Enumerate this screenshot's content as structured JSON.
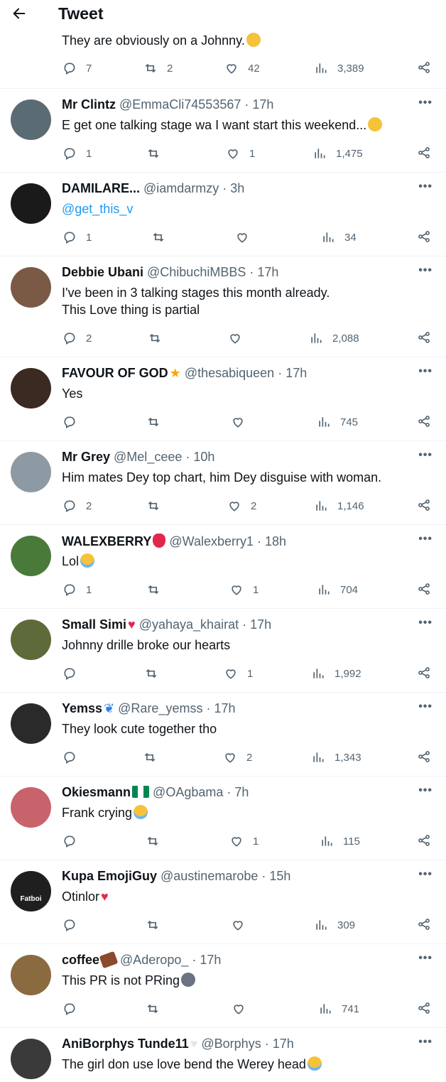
{
  "header": {
    "title": "Tweet"
  },
  "top": {
    "text": "They are obviously on a Johnny.",
    "emoji": "smiling-face-emoji",
    "replies": "7",
    "retweets": "2",
    "likes": "42",
    "views": "3,389"
  },
  "replies": [
    {
      "name": "Mr Clintz",
      "name_emoji": "",
      "handle": "@EmmaCli74553567",
      "time": "17h",
      "text": "E get one talking stage wa I want start this weekend...",
      "text_emoji": "sad-face-emoji",
      "is_link": false,
      "replies": "1",
      "retweets": "",
      "likes": "1",
      "views": "1,475",
      "avatar_color": "#5b6b74"
    },
    {
      "name": "DAMILARE...",
      "name_emoji": "",
      "handle": "@iamdarmzy",
      "time": "3h",
      "text": "@get_this_v",
      "text_emoji": "",
      "is_link": true,
      "replies": "1",
      "retweets": "",
      "likes": "",
      "views": "34",
      "avatar_color": "#1a1a1a"
    },
    {
      "name": "Debbie Ubani",
      "name_emoji": "",
      "handle": "@ChibuchiMBBS",
      "time": "17h",
      "text": "I've been in 3 talking stages this month already.\nThis Love thing is partial",
      "text_emoji": "",
      "is_link": false,
      "replies": "2",
      "retweets": "",
      "likes": "",
      "views": "2,088",
      "avatar_color": "#7a5a44"
    },
    {
      "name": "FAVOUR OF GOD",
      "name_emoji": "star-emoji",
      "handle": "@thesabiqueen",
      "time": "17h",
      "text": "Yes",
      "text_emoji": "",
      "is_link": false,
      "replies": "",
      "retweets": "",
      "likes": "",
      "views": "745",
      "avatar_color": "#3b2a22"
    },
    {
      "name": "Mr Grey",
      "name_emoji": "",
      "handle": "@Mel_ceee",
      "time": "10h",
      "text": "Him mates Dey  top chart, him Dey disguise with woman.",
      "text_emoji": "",
      "is_link": false,
      "replies": "2",
      "retweets": "",
      "likes": "2",
      "views": "1,146",
      "avatar_color": "#8e9aa3"
    },
    {
      "name": "WALEXBERRY",
      "name_emoji": "strawberry-emoji",
      "handle": "@Walexberry1",
      "time": "18h",
      "text": "Lol",
      "text_emoji": "crying-laughing-emoji",
      "is_link": false,
      "replies": "1",
      "retweets": "",
      "likes": "1",
      "views": "704",
      "avatar_color": "#4a7a3a"
    },
    {
      "name": "Small Simi",
      "name_emoji": "red-heart-emoji",
      "handle": "@yahaya_khairat",
      "time": "17h",
      "text": "Johnny drille broke our hearts",
      "text_emoji": "",
      "is_link": false,
      "replies": "",
      "retweets": "",
      "likes": "1",
      "views": "1,992",
      "avatar_color": "#5d6b3a"
    },
    {
      "name": "Yemss",
      "name_emoji": "butterfly-emoji",
      "handle": "@Rare_yemss",
      "time": "17h",
      "text": "They look cute together tho",
      "text_emoji": "",
      "is_link": false,
      "replies": "",
      "retweets": "",
      "likes": "2",
      "views": "1,343",
      "avatar_color": "#2a2a2a"
    },
    {
      "name": "Okiesmann",
      "name_emoji": "nigeria-flag-emoji",
      "handle": "@OAgbama",
      "time": "7h",
      "text": "Frank crying",
      "text_emoji": "loudly-crying-emoji",
      "is_link": false,
      "replies": "",
      "retweets": "",
      "likes": "1",
      "views": "115",
      "avatar_color": "#c9636b"
    },
    {
      "name": "Kupa EmojiGuy",
      "name_emoji": "",
      "handle": "@austinemarobe",
      "time": "15h",
      "text": "Otinlor",
      "text_emoji": "broken-heart-emoji",
      "is_link": false,
      "replies": "",
      "retweets": "",
      "likes": "",
      "views": "309",
      "avatar_color": "#1f1f1f",
      "avatar_text": "Fatboi"
    },
    {
      "name": "coffee",
      "name_emoji": "chocolate-emoji",
      "handle": "@Aderopo_",
      "time": "17h",
      "text": "This PR is not PRing",
      "text_emoji": "grimacing-emoji",
      "is_link": false,
      "replies": "",
      "retweets": "",
      "likes": "",
      "views": "741",
      "avatar_color": "#8a6a3f"
    },
    {
      "name": "AniBorphys Tunde11",
      "name_emoji": "white-heart-emoji",
      "handle": "@Borphys",
      "time": "17h",
      "text": "The girl don use love bend the Werey head",
      "text_emoji": "crying-laughing-emoji",
      "is_link": false,
      "replies": "",
      "retweets": "",
      "likes": "",
      "views": "",
      "avatar_color": "#3a3a3a"
    }
  ],
  "icons": {
    "back": "arrow-left-icon",
    "reply": "reply-icon",
    "retweet": "retweet-icon",
    "like": "heart-icon",
    "views": "views-icon",
    "share": "share-icon",
    "more": "more-icon"
  }
}
